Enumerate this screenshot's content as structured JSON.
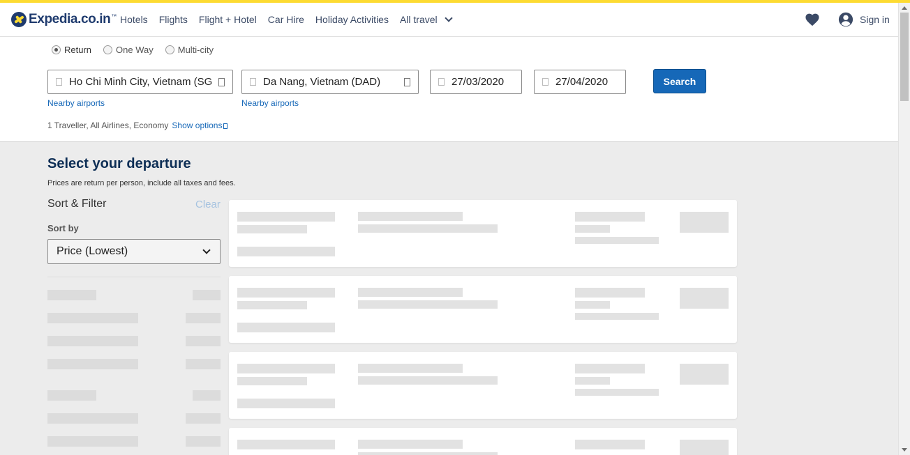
{
  "header": {
    "logo_text": "Expedia.co.in",
    "nav": [
      "Hotels",
      "Flights",
      "Flight + Hotel",
      "Car Hire",
      "Holiday Activities"
    ],
    "more_label": "All travel",
    "sign_in": "Sign in",
    "accent_color": "#fddb32",
    "brand_color": "#1f3b6e"
  },
  "search": {
    "trip_types": [
      {
        "label": "Return",
        "selected": true
      },
      {
        "label": "One Way",
        "selected": false
      },
      {
        "label": "Multi-city",
        "selected": false
      }
    ],
    "origin": "Ho Chi Minh City, Vietnam (SGN)",
    "destination": "Da Nang, Vietnam (DAD)",
    "depart_date": "27/03/2020",
    "return_date": "27/04/2020",
    "nearby_label": "Nearby airports",
    "search_button": "Search",
    "travellers_summary": "1 Traveller, All Airlines, Economy",
    "show_options": "Show options"
  },
  "results": {
    "title": "Select your departure",
    "note": "Prices are return per person, include all taxes and fees.",
    "loading": true
  },
  "filters": {
    "title": "Sort & Filter",
    "clear": "Clear",
    "sort_label": "Sort by",
    "sort_value": "Price (Lowest)"
  }
}
